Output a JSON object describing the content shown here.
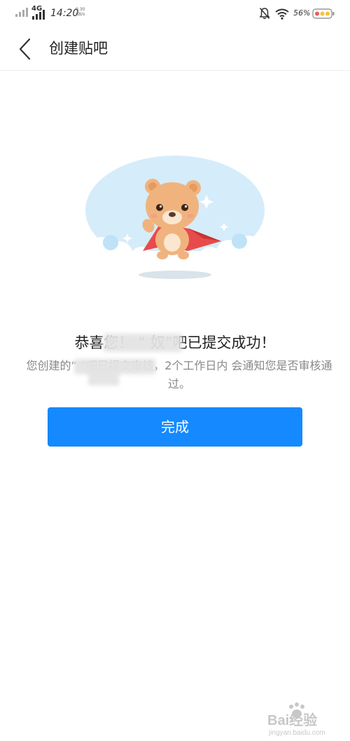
{
  "status_bar": {
    "network": "4G",
    "time": "14:20",
    "net_speed_value": "9.30",
    "net_speed_unit": "KB/s",
    "battery": "56%"
  },
  "header": {
    "title": "创建贴吧"
  },
  "message": {
    "title": "恭喜您！  “        奴”吧已提交成功！",
    "description": "您创建的“        ”吧已提交审核，2个工作日内 会通知您是否审核通过。"
  },
  "done_button": {
    "label": "完成"
  },
  "watermark": {
    "brand": "Bai经验",
    "url": "jingyan.baidu.com"
  },
  "colors": {
    "accent": "#1589ff",
    "bear": "#f0b37e",
    "cape": "#e84b4b",
    "sky": "#d5ecfa"
  }
}
